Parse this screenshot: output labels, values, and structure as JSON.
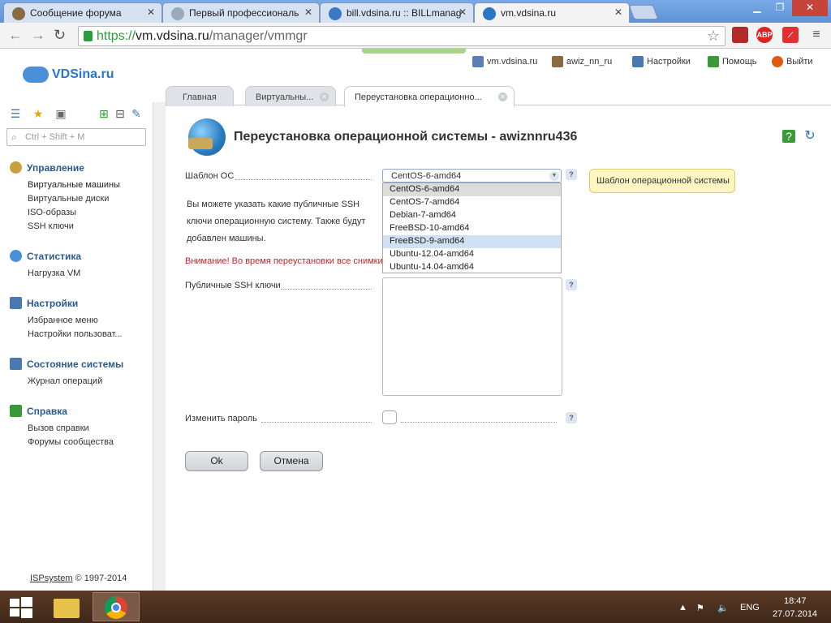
{
  "browser": {
    "tabs": [
      {
        "title": "Сообщение форума"
      },
      {
        "title": "Первый профессиональ"
      },
      {
        "title": "bill.vdsina.ru :: BILLmanag"
      },
      {
        "title": "vm.vdsina.ru"
      }
    ],
    "url_secure": "https://",
    "url_host": "vm.vdsina.ru",
    "url_path": "/manager/vmmgr",
    "ext_abp": "ABP"
  },
  "header": {
    "logo": "VDSina.ru",
    "host": "vm.vdsina.ru",
    "user": "awiz_nn_ru",
    "settings": "Настройки",
    "help": "Помощь",
    "logout": "Выйти"
  },
  "app_tabs": [
    {
      "label": "Главная"
    },
    {
      "label": "Виртуальны..."
    },
    {
      "label": "Переустановка операционно..."
    }
  ],
  "sidebar": {
    "search_placeholder": "Ctrl + Shift + M",
    "sections": [
      {
        "title": "Управление",
        "items": [
          "Виртуальные машины",
          "Виртуальные диски",
          "ISO-образы",
          "SSH ключи"
        ]
      },
      {
        "title": "Статистика",
        "items": [
          "Нагрузка VM"
        ]
      },
      {
        "title": "Настройки",
        "items": [
          "Избранное меню",
          "Настройки пользоват..."
        ]
      },
      {
        "title": "Состояние системы",
        "items": [
          "Журнал операций"
        ]
      },
      {
        "title": "Справка",
        "items": [
          "Вызов справки",
          "Форумы сообщества"
        ]
      }
    ],
    "copyright_link": "ISPsystem",
    "copyright_years": " © 1997-2014"
  },
  "form": {
    "title": "Переустановка операционной системы - awiznnru436",
    "os_label": "Шаблон ОС",
    "os_value": "CentOS-6-amd64",
    "os_options": [
      "CentOS-6-amd64",
      "CentOS-7-amd64",
      "Debian-7-amd64",
      "FreeBSD-10-amd64",
      "FreeBSD-9-amd64",
      "Ubuntu-12.04-amd64",
      "Ubuntu-14.04-amd64"
    ],
    "os_tooltip": "Шаблон операционной системы",
    "description": "Вы можете указать какие публичные SSH ключи операционную систему. Также будут добавлен машины.",
    "warning": "Внимание! Во время переустановки все снимки",
    "ssh_label": "Публичные SSH ключи",
    "password_label": "Изменить пароль",
    "help_mark": "?",
    "ok": "Ok",
    "cancel": "Отмена"
  },
  "taskbar": {
    "lang": "ENG",
    "time": "18:47",
    "date": "27.07.2014"
  }
}
